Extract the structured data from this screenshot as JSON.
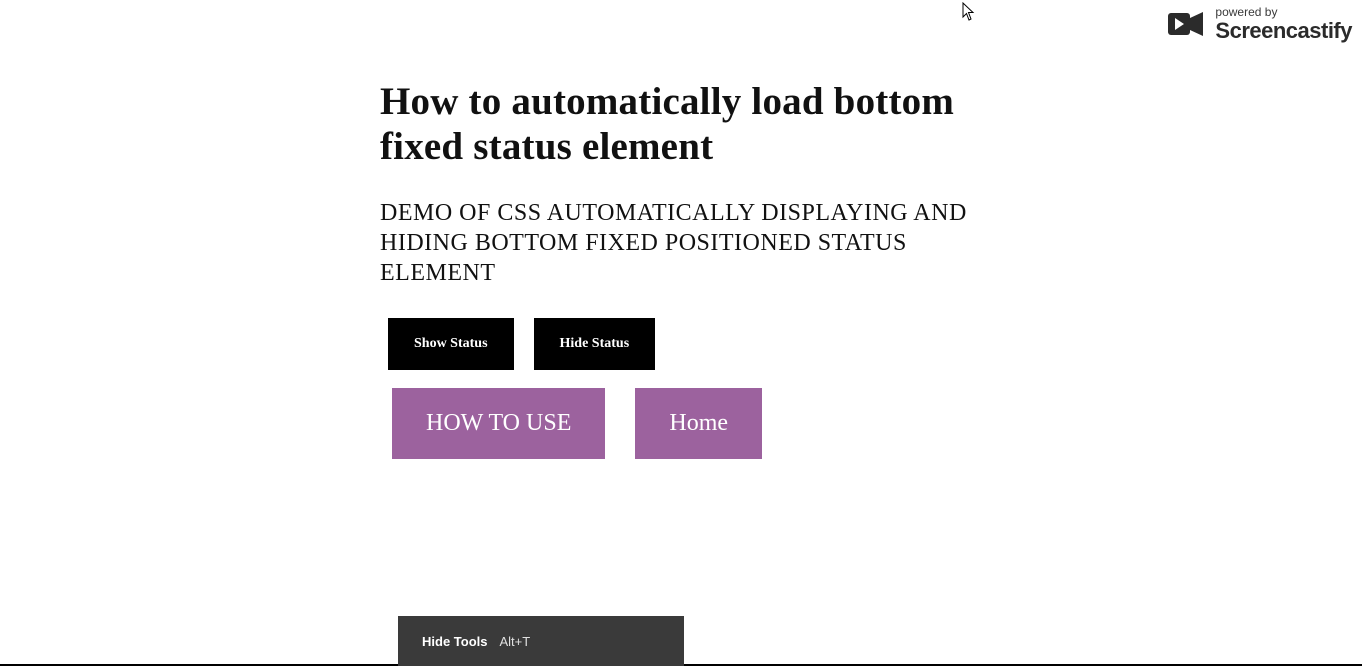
{
  "heading": "How to automatically load bottom fixed status element",
  "subheading": "DEMO OF CSS AUTOMATICALLY DISPLAYING AND HIDING BOTTOM FIXED POSITIONED STATUS ELEMENT",
  "buttons": {
    "show_status": "Show Status",
    "hide_status": "Hide Status",
    "how_to_use": "HOW TO USE",
    "home": "Home"
  },
  "toolbar": {
    "hide_tools_label": "Hide Tools",
    "hide_tools_shortcut": "Alt+T"
  },
  "watermark": {
    "powered": "powered by",
    "brand": "Screencastify"
  }
}
